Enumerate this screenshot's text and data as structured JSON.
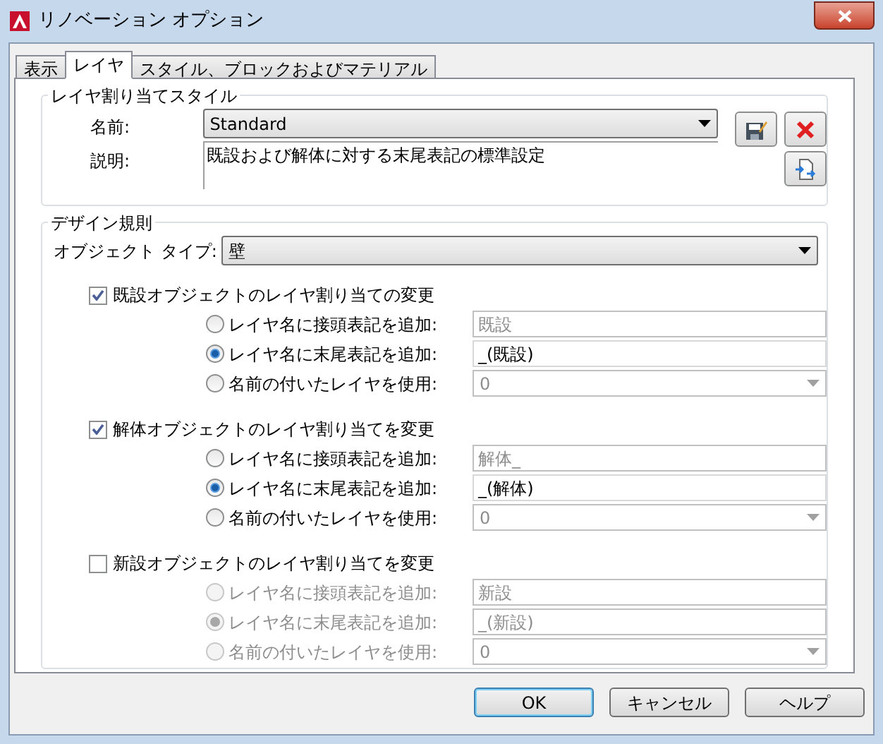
{
  "window": {
    "title": "リノベーション オプション"
  },
  "tabs": [
    {
      "label": "表示",
      "selected": false
    },
    {
      "label": "レイヤ",
      "selected": true
    },
    {
      "label": "スタイル、ブロックおよびマテリアル",
      "selected": false
    }
  ],
  "style_group": {
    "title": "レイヤ割り当てスタイル",
    "name_label": "名前:",
    "name_value": "Standard",
    "description_label": "説明:",
    "description": "既設および解体に対する末尾表記の標準設定"
  },
  "design_rules": {
    "title": "デザイン規則",
    "object_type_label": "オブジェクト タイプ:",
    "object_type_value": "壁",
    "groups": [
      {
        "label": "既設オブジェクトのレイヤ割り当ての変更",
        "checked": true,
        "options": [
          {
            "label": "レイヤ名に接頭表記を追加:",
            "selected": false,
            "kind": "text",
            "value": "既設"
          },
          {
            "label": "レイヤ名に末尾表記を追加:",
            "selected": true,
            "kind": "text",
            "value": "_(既設)"
          },
          {
            "label": "名前の付いたレイヤを使用:",
            "selected": false,
            "kind": "dropdown",
            "value": "0"
          }
        ]
      },
      {
        "label": "解体オブジェクトのレイヤ割り当てを変更",
        "checked": true,
        "options": [
          {
            "label": "レイヤ名に接頭表記を追加:",
            "selected": false,
            "kind": "text",
            "value": "解体_"
          },
          {
            "label": "レイヤ名に末尾表記を追加:",
            "selected": true,
            "kind": "text",
            "value": "_(解体)"
          },
          {
            "label": "名前の付いたレイヤを使用:",
            "selected": false,
            "kind": "dropdown",
            "value": "0"
          }
        ]
      },
      {
        "label": "新設オブジェクトのレイヤ割り当てを変更",
        "checked": false,
        "options": [
          {
            "label": "レイヤ名に接頭表記を追加:",
            "selected": false,
            "kind": "text",
            "value": "新設"
          },
          {
            "label": "レイヤ名に末尾表記を追加:",
            "selected": true,
            "kind": "text",
            "value": "_(新設)"
          },
          {
            "label": "名前の付いたレイヤを使用:",
            "selected": false,
            "kind": "dropdown",
            "value": "0"
          }
        ]
      }
    ]
  },
  "buttons": [
    {
      "label": "OK",
      "default": true
    },
    {
      "label": "キャンセル",
      "default": false
    },
    {
      "label": "ヘルプ",
      "default": false
    }
  ]
}
